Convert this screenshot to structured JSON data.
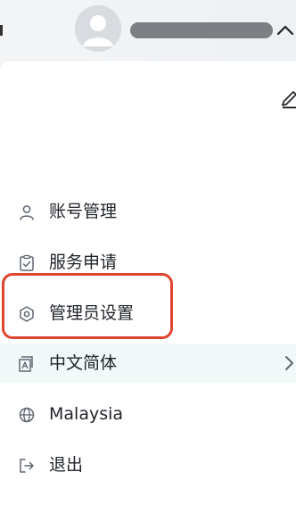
{
  "header": {
    "avatar": "default-user-avatar",
    "caret_icon": "chevron-up-icon"
  },
  "panel": {
    "edit_icon": "edit-pencil-icon",
    "menu": {
      "account": {
        "label": "账号管理",
        "icon": "user-icon"
      },
      "service": {
        "label": "服务申请",
        "icon": "clipboard-check-icon"
      },
      "admin": {
        "label": "管理员设置",
        "icon": "hexagon-settings-icon"
      },
      "language": {
        "label": "中文简体",
        "icon": "translate-icon",
        "chevron": "chevron-right-icon"
      },
      "region": {
        "label": "Malaysia",
        "icon": "globe-icon"
      },
      "logout": {
        "label": "退出",
        "icon": "logout-icon"
      }
    }
  },
  "colors": {
    "highlight_border": "#e0452f",
    "language_row_bg": "#f2faf9",
    "icon_stroke": "#5f6670"
  }
}
